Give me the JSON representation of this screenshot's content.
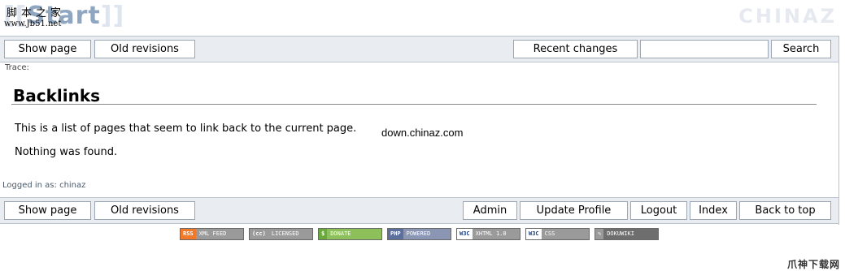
{
  "header": {
    "logo_text_left": "[[",
    "logo_text_mid": "Start",
    "logo_text_right": "]]",
    "site_cn": "脚本之家",
    "site_url": "www.Jb51.net",
    "watermark": "CHINAZ"
  },
  "top_bar": {
    "show_page": "Show page",
    "old_revisions": "Old revisions",
    "recent_changes": "Recent changes",
    "search_value": "",
    "search_button": "Search"
  },
  "trace_label": "Trace:",
  "main": {
    "title": "Backlinks",
    "intro": "This is a list of pages that seem to link back to the current page.",
    "inline_watermark": "down.chinaz.com",
    "result": "Nothing was found."
  },
  "logged_in": "Logged in as: chinaz",
  "bottom_bar": {
    "show_page": "Show page",
    "old_revisions": "Old revisions",
    "admin": "Admin",
    "update_profile": "Update Profile",
    "logout": "Logout",
    "index": "Index",
    "back_to_top": "Back to top"
  },
  "badges": [
    {
      "left": "RSS",
      "right": "XML FEED",
      "icon": "rss-icon",
      "color_left": "#f2782a",
      "color_right": "#9a9a9a"
    },
    {
      "left": "(cc)",
      "right": "LICENSED",
      "icon": "cc-icon",
      "color_left": "#9a9a9a",
      "color_right": "#9a9a9a"
    },
    {
      "left": "$",
      "right": "DONATE",
      "icon": "dollar-icon",
      "color_left": "#6aaa3c",
      "color_right": "#8dbf5a"
    },
    {
      "left": "PHP",
      "right": "POWERED",
      "icon": "php-icon",
      "color_left": "#5d6f9c",
      "color_right": "#8a96b4"
    },
    {
      "left": "W3C",
      "right": "XHTML 1.0",
      "icon": "w3c-icon",
      "color_left": "#ffffff",
      "color_right": "#9a9a9a"
    },
    {
      "left": "W3C",
      "right": "CSS",
      "icon": "w3c-icon",
      "color_left": "#ffffff",
      "color_right": "#9a9a9a"
    },
    {
      "left": "✎",
      "right": "DOKUWIKI",
      "icon": "dokuwiki-icon",
      "color_left": "#9a9a9a",
      "color_right": "#6e6e6e"
    }
  ],
  "corner_watermark": "爪神下载网"
}
